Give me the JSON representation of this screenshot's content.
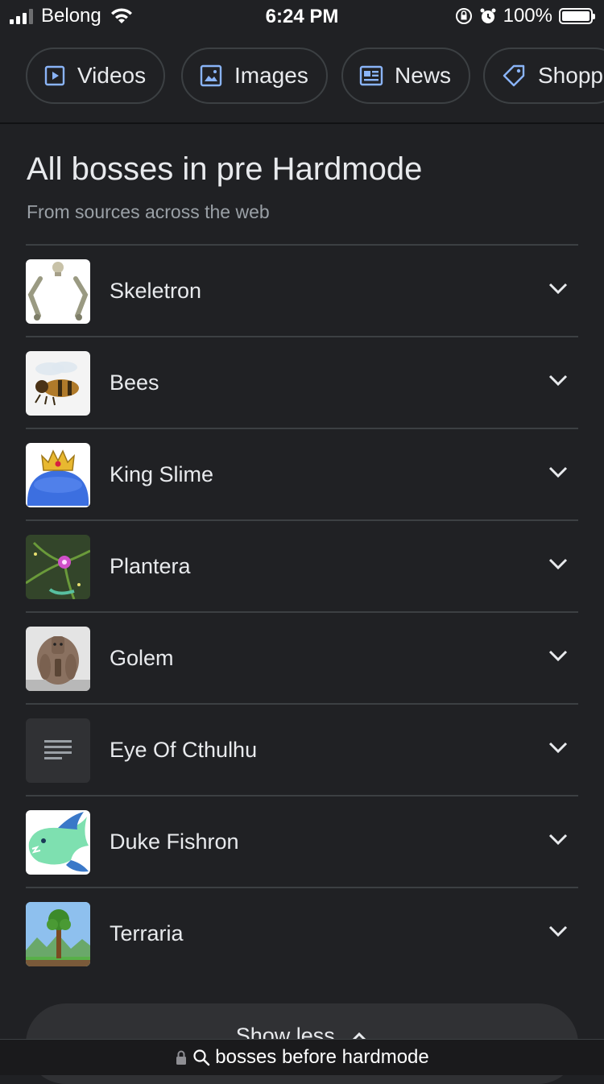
{
  "status": {
    "carrier": "Belong",
    "time": "6:24 PM",
    "battery": "100%"
  },
  "chips": [
    {
      "label": "Videos",
      "icon": "play-box-icon"
    },
    {
      "label": "Images",
      "icon": "image-icon"
    },
    {
      "label": "News",
      "icon": "newspaper-icon"
    },
    {
      "label": "Shopp",
      "icon": "tag-icon"
    }
  ],
  "section": {
    "title": "All bosses in pre Hardmode",
    "subtitle": "From sources across the web"
  },
  "items": [
    {
      "label": "Skeletron",
      "thumb": "skeletron-thumbnail"
    },
    {
      "label": "Bees",
      "thumb": "bee-thumbnail"
    },
    {
      "label": "King Slime",
      "thumb": "king-slime-thumbnail"
    },
    {
      "label": "Plantera",
      "thumb": "plantera-thumbnail"
    },
    {
      "label": "Golem",
      "thumb": "golem-thumbnail"
    },
    {
      "label": "Eye Of Cthulhu",
      "thumb": "text-placeholder-thumbnail"
    },
    {
      "label": "Duke Fishron",
      "thumb": "duke-fishron-thumbnail"
    },
    {
      "label": "Terraria",
      "thumb": "terraria-tree-thumbnail"
    }
  ],
  "show_less_label": "Show less",
  "urlbar": {
    "query": "bosses before hardmode"
  },
  "colors": {
    "background": "#202124",
    "chip_border": "#3c4043",
    "accent_icon": "#8ab4f8",
    "secondary_text": "#9aa0a6"
  }
}
